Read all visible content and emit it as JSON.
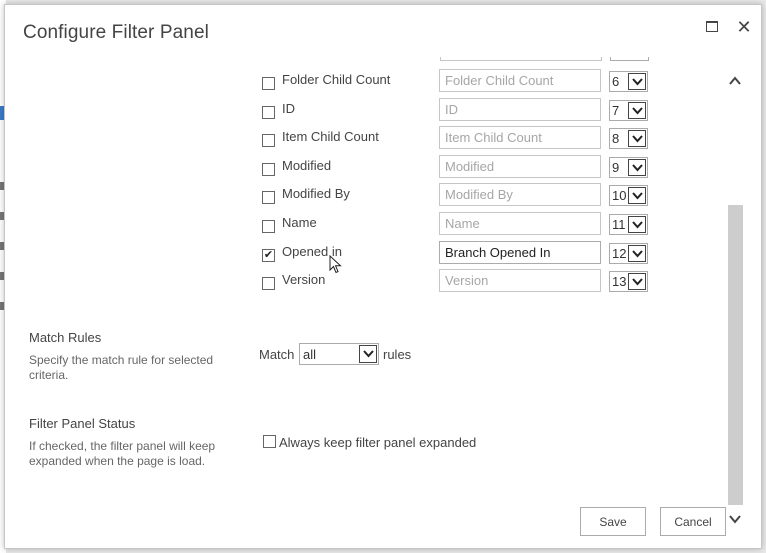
{
  "dialog": {
    "title": "Configure Filter Panel"
  },
  "fields": [
    {
      "label": "Folder Child Count",
      "checked": false,
      "value": "",
      "placeholder": "Folder Child Count",
      "order": "6"
    },
    {
      "label": "ID",
      "checked": false,
      "value": "",
      "placeholder": "ID",
      "order": "7"
    },
    {
      "label": "Item Child Count",
      "checked": false,
      "value": "",
      "placeholder": "Item Child Count",
      "order": "8"
    },
    {
      "label": "Modified",
      "checked": false,
      "value": "",
      "placeholder": "Modified",
      "order": "9"
    },
    {
      "label": "Modified By",
      "checked": false,
      "value": "",
      "placeholder": "Modified By",
      "order": "10"
    },
    {
      "label": "Name",
      "checked": false,
      "value": "",
      "placeholder": "Name",
      "order": "11"
    },
    {
      "label": "Opened in",
      "checked": true,
      "value": "Branch Opened In",
      "placeholder": "",
      "order": "12"
    },
    {
      "label": "Version",
      "checked": false,
      "value": "",
      "placeholder": "Version",
      "order": "13"
    }
  ],
  "match_rules": {
    "title": "Match Rules",
    "description": "Specify the match rule for selected criteria.",
    "prefix": "Match",
    "selected": "all",
    "suffix": "rules"
  },
  "filter_panel_status": {
    "title": "Filter Panel Status",
    "description": "If checked, the filter panel will keep expanded when the page is load.",
    "checkbox_label": "Always keep filter panel expanded",
    "checked": false
  },
  "buttons": {
    "save": "Save",
    "cancel": "Cancel"
  }
}
